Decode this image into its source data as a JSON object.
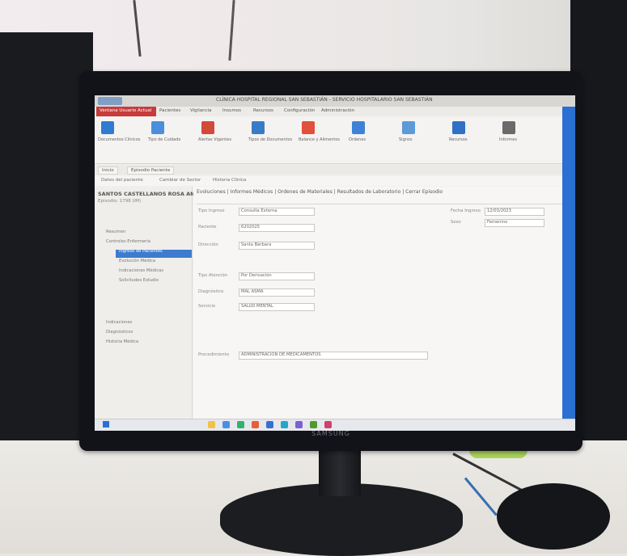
{
  "monitor": {
    "brand": "SAMSUNG"
  },
  "app": {
    "title": "CLÍNICA HOSPITAL REGIONAL SAN SEBASTIÁN - SERVICIO HOSPITALARIO SAN SEBASTIÁN",
    "menu": [
      "Ventana Usuario Actual",
      "Pacientes",
      "Vigilancia",
      "Insumos",
      "Recursos",
      "Configuración",
      "Administración"
    ]
  },
  "ribbon": {
    "groups": [
      {
        "label": "Documentos Clínicos",
        "color": "#2e7bd1"
      },
      {
        "label": "Tipo de Cuidado",
        "color": "#4b8fdc"
      },
      {
        "label": "Alertas Vigentes",
        "color": "#d24a3a"
      },
      {
        "label": "Tipos de Documentos",
        "color": "#3a7bc6"
      },
      {
        "label": "Balance y Alimentos",
        "color": "#e0503a"
      },
      {
        "label": "Ordenes",
        "color": "#3d82d6"
      },
      {
        "label": "Signos",
        "color": "#5c9ad8"
      },
      {
        "label": "Recursos",
        "color": "#3170c4"
      },
      {
        "label": "Informes",
        "color": "#6a6a6a"
      }
    ]
  },
  "tabs": [
    "Inicio",
    "Episodio Paciente"
  ],
  "toolbar": [
    "Datos del paciente",
    "Cambiar de Sector",
    "Historia Clínica"
  ],
  "patient": {
    "name": "SANTOS CASTELLANOS ROSA ANA",
    "sub": "Episodio: 1798 (IM)"
  },
  "sidebar": {
    "items": [
      "Resumen",
      "Controles Enfermería",
      "Ingreso de Pacientes",
      "Evolución Médica",
      "Indicaciones Médicas",
      "Solicitudes Estudio",
      "Indicaciones",
      "Diagnósticos",
      "Historia Médica"
    ],
    "selected_index": 2
  },
  "main": {
    "section_tabs": "Evoluciones  |  Informes Médicos  |  Ordenes de Materiales  |  Resultados de Laboratorio  |  Cerrar Episodio",
    "fields": [
      {
        "label": "Tipo Ingreso",
        "value": "Consulta Externa"
      },
      {
        "label": "Paciente",
        "value": "6202025"
      },
      {
        "label": "Dirección",
        "value": "Santa Bárbara"
      },
      {
        "label": "Tipo Atención",
        "value": "Por Derivación"
      },
      {
        "label": "Diagnóstico",
        "value": "MAL ASMA"
      },
      {
        "label": "Servicio",
        "value": "SALUD MENTAL"
      },
      {
        "label": "Procedimiento",
        "value": "ADMINISTRACIÓN DE MEDICAMENTOS"
      }
    ],
    "right_fields": [
      {
        "label": "Fecha Ingreso",
        "value": "12/03/2023"
      },
      {
        "label": "Sexo",
        "value": "Femenino"
      }
    ]
  },
  "colors": {
    "accent": "#c73b3b",
    "selection": "#3d7bd0",
    "taskbar": "#e7e8ec"
  }
}
